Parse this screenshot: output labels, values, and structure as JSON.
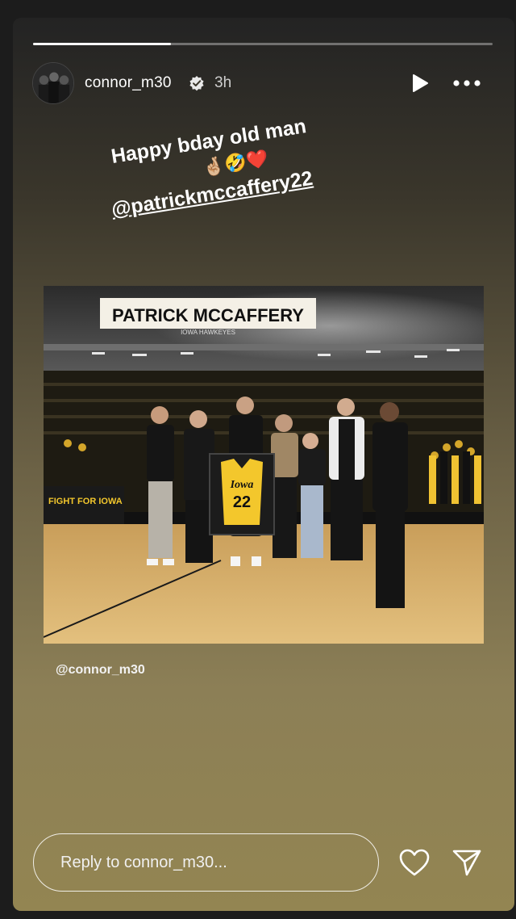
{
  "story": {
    "progress": 0.3,
    "username": "connor_m30",
    "timestamp": "3h",
    "verified": true
  },
  "caption": {
    "line1": "Happy bday old man",
    "emoji": "🤞🏼🤣❤️",
    "mention": "@patrickmccaffery22"
  },
  "photo": {
    "banner_title": "PATRICK MCCAFFERY",
    "banner_subtitle": "IOWA HAWKEYES",
    "jersey_text": "Iowa",
    "jersey_number": "22",
    "table_sign": "FIGHT FOR IOWA",
    "tag": "@connor_m30"
  },
  "reply": {
    "placeholder": "Reply to connor_m30..."
  },
  "icons": {
    "play": "play-icon",
    "more": "more-horizontal-icon",
    "heart": "heart-icon",
    "send": "send-icon",
    "verified": "verified-badge-icon"
  },
  "colors": {
    "accent_gold": "#f3c72c",
    "story_bottom": "#938552"
  }
}
